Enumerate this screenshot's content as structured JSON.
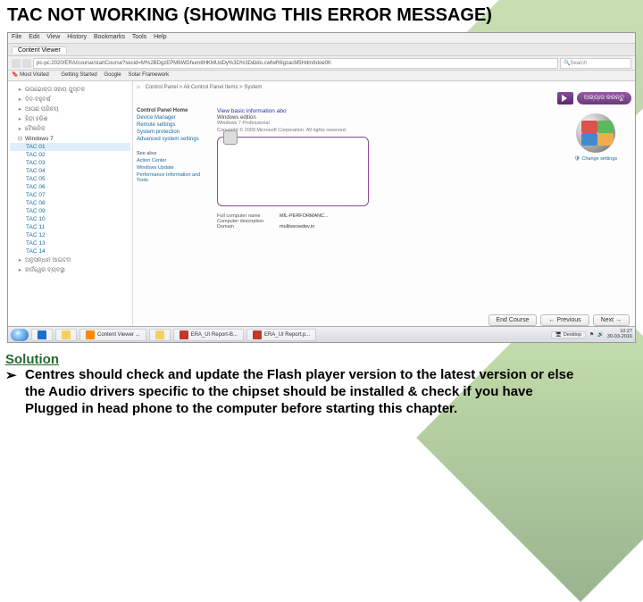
{
  "title": "TAC NOT WORKING (SHOWING THIS ERROR MESSAGE)",
  "browser": {
    "menu": [
      "File",
      "Edit",
      "View",
      "History",
      "Bookmarks",
      "Tools",
      "Help"
    ],
    "tab": "Content Viewer",
    "url": "pc-pc:2020/ERA/course/startCourse?secid=M%2BDgzEPM6WDhum8HKMUdDy%3D%3D&ldo.cwfwR6gzacM5Hdm8doe0K",
    "search_placeholder": "Search",
    "bookmarks_label": "Most Visited",
    "bookmarks": [
      "Getting Started",
      "Google",
      "Solar Framework"
    ]
  },
  "tree": {
    "odia_items": [
      "ଉପଭୋକ୍ତା ସହାୟ ପୁସ୍ତକ",
      "ଦିବ-ବହୁବର୍ଷ",
      "ଆପଣ ପରିଚୟ",
      "ହିନ୍ଦୀ ହରିଶ",
      "ବୈଜ୍ଞାନିକ"
    ],
    "expanded": "Windows 7",
    "sub": [
      "TAC 01",
      "TAC 02",
      "TAC 03",
      "TAC 04",
      "TAC 05",
      "TAC 06",
      "TAC 07",
      "TAC 08",
      "TAC 09",
      "TAC 10",
      "TAC 11",
      "TAC 12",
      "TAC 13",
      "TAC 14"
    ],
    "bottom": [
      "ଅନୁସନ୍ଧାନ ଆଇଟମ",
      "ହାର୍ଡୱେର ବ୍ୟବସ୍ଥା"
    ]
  },
  "system": {
    "breadcrumb": "Control Panel > All Control Panel Items > System",
    "left_header": "Control Panel Home",
    "left_links": [
      "Device Manager",
      "Remote settings",
      "System protection",
      "Advanced system settings"
    ],
    "odia_button": "ଅଭ୍ୟାସ କରନ୍ତୁ",
    "info_title": "View basic information abo",
    "edition_hdr": "Windows edition",
    "edition": "Windows 7 Professional",
    "copyright": "Copyright © 2009 Microsoft Corporation. All rights reserved.",
    "props": [
      {
        "k": "Full computer name",
        "v": "MIL-PERFORMANC..."
      },
      {
        "k": "Computer description",
        "v": ""
      },
      {
        "k": "Domain",
        "v": "multiversedev.in"
      }
    ],
    "change_link": "Change settings",
    "seealso_hdr": "See also",
    "seealso": [
      "Action Center",
      "Windows Update",
      "Performance Information and Tools"
    ]
  },
  "navbar": {
    "end": "End Course",
    "prev": "← Previous",
    "next": "Next →"
  },
  "taskbar": {
    "items": [
      "Content Viewer ...",
      "",
      "ERA_UI Report-B...",
      "ERA_UI Report.p..."
    ],
    "show_desktop": "Desktop",
    "time": "10:27",
    "date": "30-03-2016"
  },
  "solution": {
    "header": "Solution",
    "bullet": "➢",
    "text": "Centres should check and update the Flash player version to the latest version or else the Audio drivers specific to the chipset should be installed & check if you have Plugged in head phone to the computer before starting this chapter."
  }
}
